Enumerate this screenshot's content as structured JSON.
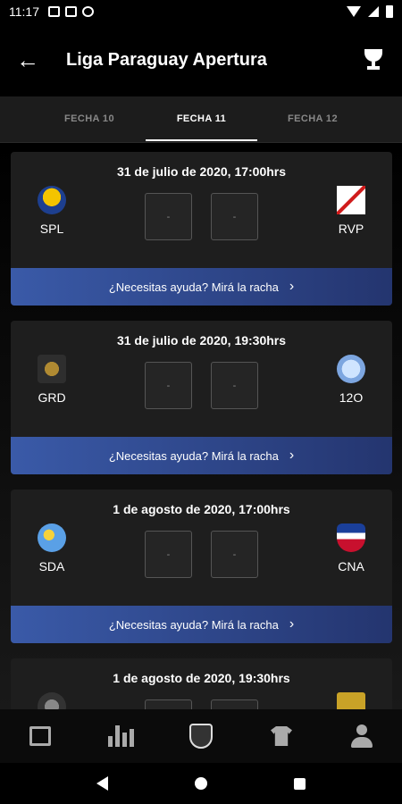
{
  "status_bar": {
    "time": "11:17"
  },
  "app_bar": {
    "back_icon": "arrow-left-icon",
    "title": "Liga Paraguay Apertura",
    "action_icon": "trophy-icon"
  },
  "tabs": [
    {
      "label": "FECHA 10",
      "active": false
    },
    {
      "label": "FECHA 11",
      "active": true
    },
    {
      "label": "FECHA 12",
      "active": false
    }
  ],
  "matches": [
    {
      "date": "31 de julio de 2020, 17:00hrs",
      "home": "SPL",
      "away": "RVP",
      "home_score": "-",
      "away_score": "-",
      "help": "¿Necesitas ayuda? Mirá la racha"
    },
    {
      "date": "31 de julio de 2020, 19:30hrs",
      "home": "GRD",
      "away": "12O",
      "home_score": "-",
      "away_score": "-",
      "help": "¿Necesitas ayuda? Mirá la racha"
    },
    {
      "date": "1 de agosto de 2020, 17:00hrs",
      "home": "SDA",
      "away": "CNA",
      "home_score": "-",
      "away_score": "-",
      "help": "¿Necesitas ayuda? Mirá la racha"
    },
    {
      "date": "1 de agosto de 2020, 19:30hrs",
      "home_score": "",
      "away_score": ""
    }
  ],
  "bottom_nav": [
    {
      "icon": "news-icon",
      "active": false
    },
    {
      "icon": "stats-icon",
      "active": false
    },
    {
      "icon": "prode-shield-icon",
      "active": true
    },
    {
      "icon": "shirt-icon",
      "active": false
    },
    {
      "icon": "profile-icon",
      "active": false
    }
  ],
  "colors": {
    "accent_gradient_start": "#3a5aa8",
    "accent_gradient_end": "#24356f",
    "card_bg": "#1e1e1e"
  }
}
